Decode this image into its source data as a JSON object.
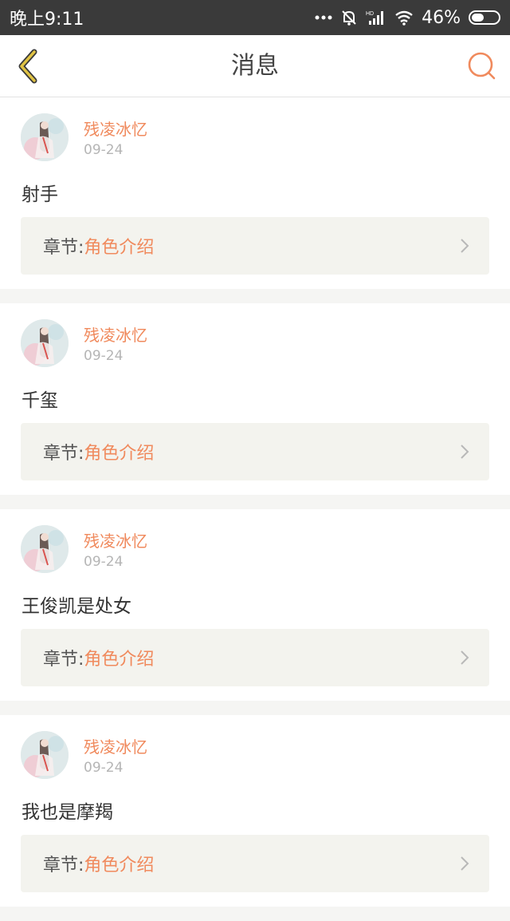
{
  "status_bar": {
    "time": "晚上9:11",
    "battery": "46%",
    "battery_level": 0.46
  },
  "nav": {
    "title": "消息",
    "back_icon": "chevron-left-icon",
    "search_icon": "search-icon"
  },
  "colors": {
    "accent": "#f08a5d",
    "back_icon": "#d9b73a"
  },
  "messages": [
    {
      "username": "残凌冰忆",
      "date": "09-24",
      "content": "射手",
      "chapter_label": "章节:",
      "chapter_name": "角色介绍"
    },
    {
      "username": "残凌冰忆",
      "date": "09-24",
      "content": "千玺",
      "chapter_label": "章节:",
      "chapter_name": "角色介绍"
    },
    {
      "username": "残凌冰忆",
      "date": "09-24",
      "content": "王俊凯是处女",
      "chapter_label": "章节:",
      "chapter_name": "角色介绍"
    },
    {
      "username": "残凌冰忆",
      "date": "09-24",
      "content": "我也是摩羯",
      "chapter_label": "章节:",
      "chapter_name": "角色介绍"
    }
  ]
}
